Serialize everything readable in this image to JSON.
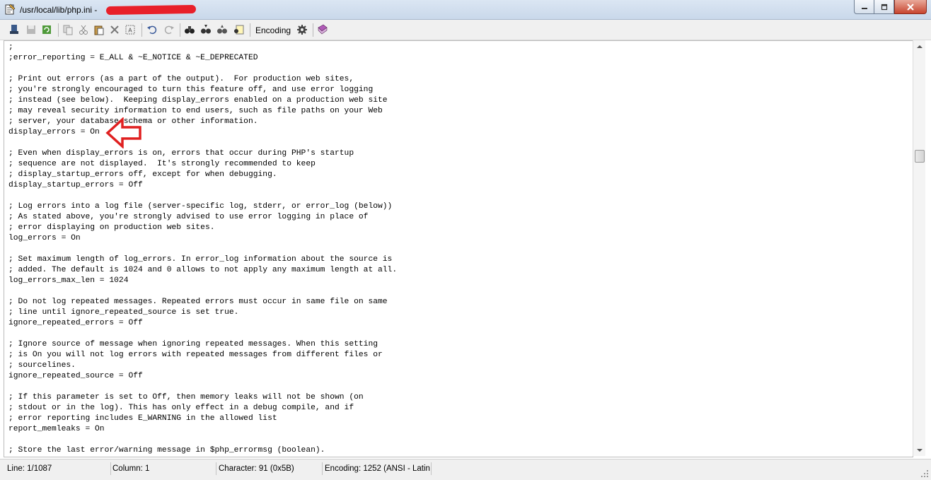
{
  "window": {
    "title": "/usr/local/lib/php.ini - ",
    "app_icon": "notepad-icon",
    "controls": {
      "minimize": "minimize-icon",
      "maximize": "maximize-icon",
      "close": "close-icon"
    }
  },
  "toolbar": {
    "encoding_label": "Encoding",
    "buttons": [
      "new-document-icon",
      "save-icon",
      "reload-icon",
      "copy-icon",
      "cut-icon",
      "paste-icon",
      "delete-icon",
      "select-all-icon",
      "undo-icon",
      "redo-icon",
      "find-icon",
      "find-next-icon",
      "find-previous-icon",
      "replace-icon",
      "encoding-gear-icon",
      "book-icon"
    ]
  },
  "editor": {
    "lines": [
      ";",
      ";error_reporting = E_ALL & ~E_NOTICE & ~E_DEPRECATED",
      "",
      "; Print out errors (as a part of the output).  For production web sites,",
      "; you're strongly encouraged to turn this feature off, and use error logging",
      "; instead (see below).  Keeping display_errors enabled on a production web site",
      "; may reveal security information to end users, such as file paths on your Web",
      "; server, your database schema or other information.",
      "display_errors = On",
      "",
      "; Even when display_errors is on, errors that occur during PHP's startup",
      "; sequence are not displayed.  It's strongly recommended to keep",
      "; display_startup_errors off, except for when debugging.",
      "display_startup_errors = Off",
      "",
      "; Log errors into a log file (server-specific log, stderr, or error_log (below))",
      "; As stated above, you're strongly advised to use error logging in place of",
      "; error displaying on production web sites.",
      "log_errors = On",
      "",
      "; Set maximum length of log_errors. In error_log information about the source is",
      "; added. The default is 1024 and 0 allows to not apply any maximum length at all.",
      "log_errors_max_len = 1024",
      "",
      "; Do not log repeated messages. Repeated errors must occur in same file on same",
      "; line until ignore_repeated_source is set true.",
      "ignore_repeated_errors = Off",
      "",
      "; Ignore source of message when ignoring repeated messages. When this setting",
      "; is On you will not log errors with repeated messages from different files or",
      "; sourcelines.",
      "ignore_repeated_source = Off",
      "",
      "; If this parameter is set to Off, then memory leaks will not be shown (on",
      "; stdout or in the log). This has only effect in a debug compile, and if",
      "; error reporting includes E_WARNING in the allowed list",
      "report_memleaks = On",
      "",
      "; Store the last error/warning message in $php_errormsg (boolean)."
    ]
  },
  "annotation": {
    "icon": "red-arrow-icon",
    "color": "#e02020"
  },
  "statusbar": {
    "line": "Line: 1/1087",
    "column": "Column: 1",
    "character": "Character: 91 (0x5B)",
    "encoding": "Encoding: 1252  (ANSI - Latin"
  }
}
